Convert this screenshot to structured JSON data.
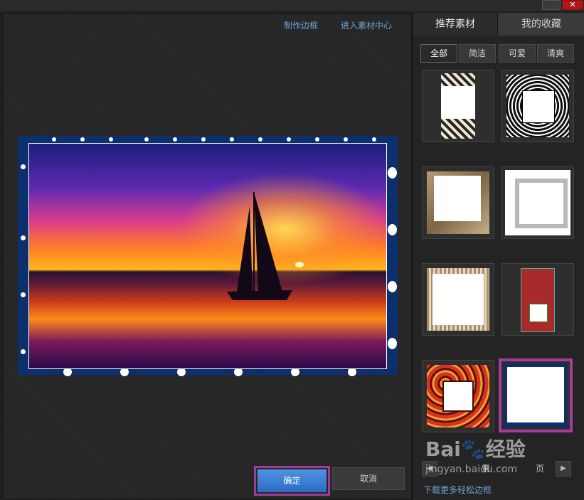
{
  "window": {
    "close_glyph": "✕"
  },
  "editor": {
    "link_make_frame": "制作边框",
    "link_material_center": "进入素材中心",
    "ok_label": "确定",
    "cancel_label": "取消"
  },
  "panel": {
    "tabs": [
      {
        "label": "推荐素材"
      },
      {
        "label": "我的收藏"
      }
    ],
    "categories": [
      {
        "label": "全部"
      },
      {
        "label": "简洁"
      },
      {
        "label": "可爱"
      },
      {
        "label": "清爽"
      }
    ],
    "pager": {
      "page_label_1": "第",
      "page_label_2": "页"
    },
    "download_more": "下载更多轻松边框"
  },
  "watermark": {
    "brand": "Bai",
    "brand_suffix": "经验",
    "url": "jingyan.baidu.com"
  },
  "colors": {
    "accent_purple": "#a23d9d",
    "link_blue": "#6fa3d6",
    "frame_navy": "#0c2f6d"
  }
}
